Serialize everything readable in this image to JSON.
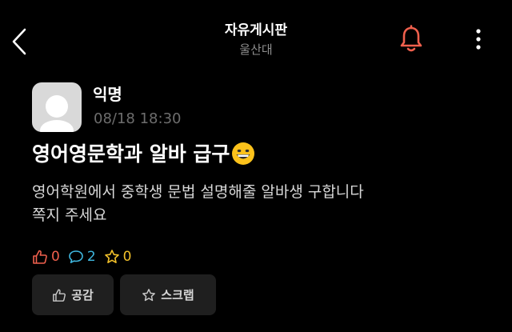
{
  "header": {
    "title": "자유게시판",
    "subtitle": "울산대",
    "back_icon": "chevron-left-icon",
    "bell_icon": "bell-icon",
    "more_icon": "more-vertical-icon"
  },
  "post": {
    "author": "익명",
    "time": "08/18 18:30",
    "title": "영어영문학과 알바 급구",
    "title_emoji": "grinning-face-emoji",
    "body_lines": [
      "영어학원에서 중학생 문법 설명해줄 알바생 구합니다",
      "쪽지 주세요"
    ],
    "stats": {
      "likes": "0",
      "comments": "2",
      "scraps": "0"
    }
  },
  "actions": {
    "like_label": "공감",
    "scrap_label": "스크랩"
  },
  "colors": {
    "background": "#000000",
    "accent_red": "#f0604d",
    "comment_blue": "#3fb8e0",
    "scrap_yellow": "#f3c12a",
    "button_bg": "#1f1f1f"
  }
}
